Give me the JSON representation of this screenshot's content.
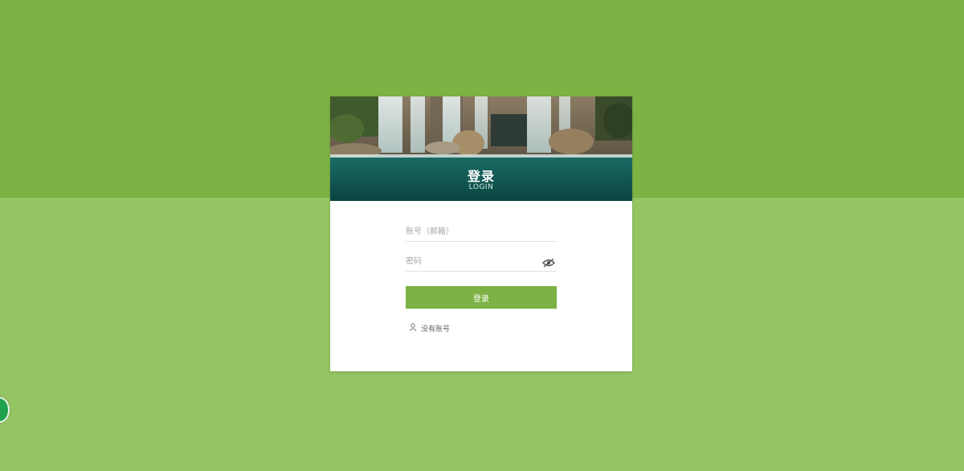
{
  "banner": {
    "title": "登录",
    "subtitle": "LOGIN"
  },
  "form": {
    "account_placeholder": "账号（邮箱）",
    "password_placeholder": "密码",
    "login_label": "登录",
    "register_label": "没有账号"
  },
  "icons": {
    "password_toggle": "eye-slash-icon",
    "register": "user-icon"
  },
  "colors": {
    "background_top": "#7db244",
    "background_bottom": "#95c462",
    "accent": "#7db244",
    "banner_water": "#0b4f4b"
  }
}
